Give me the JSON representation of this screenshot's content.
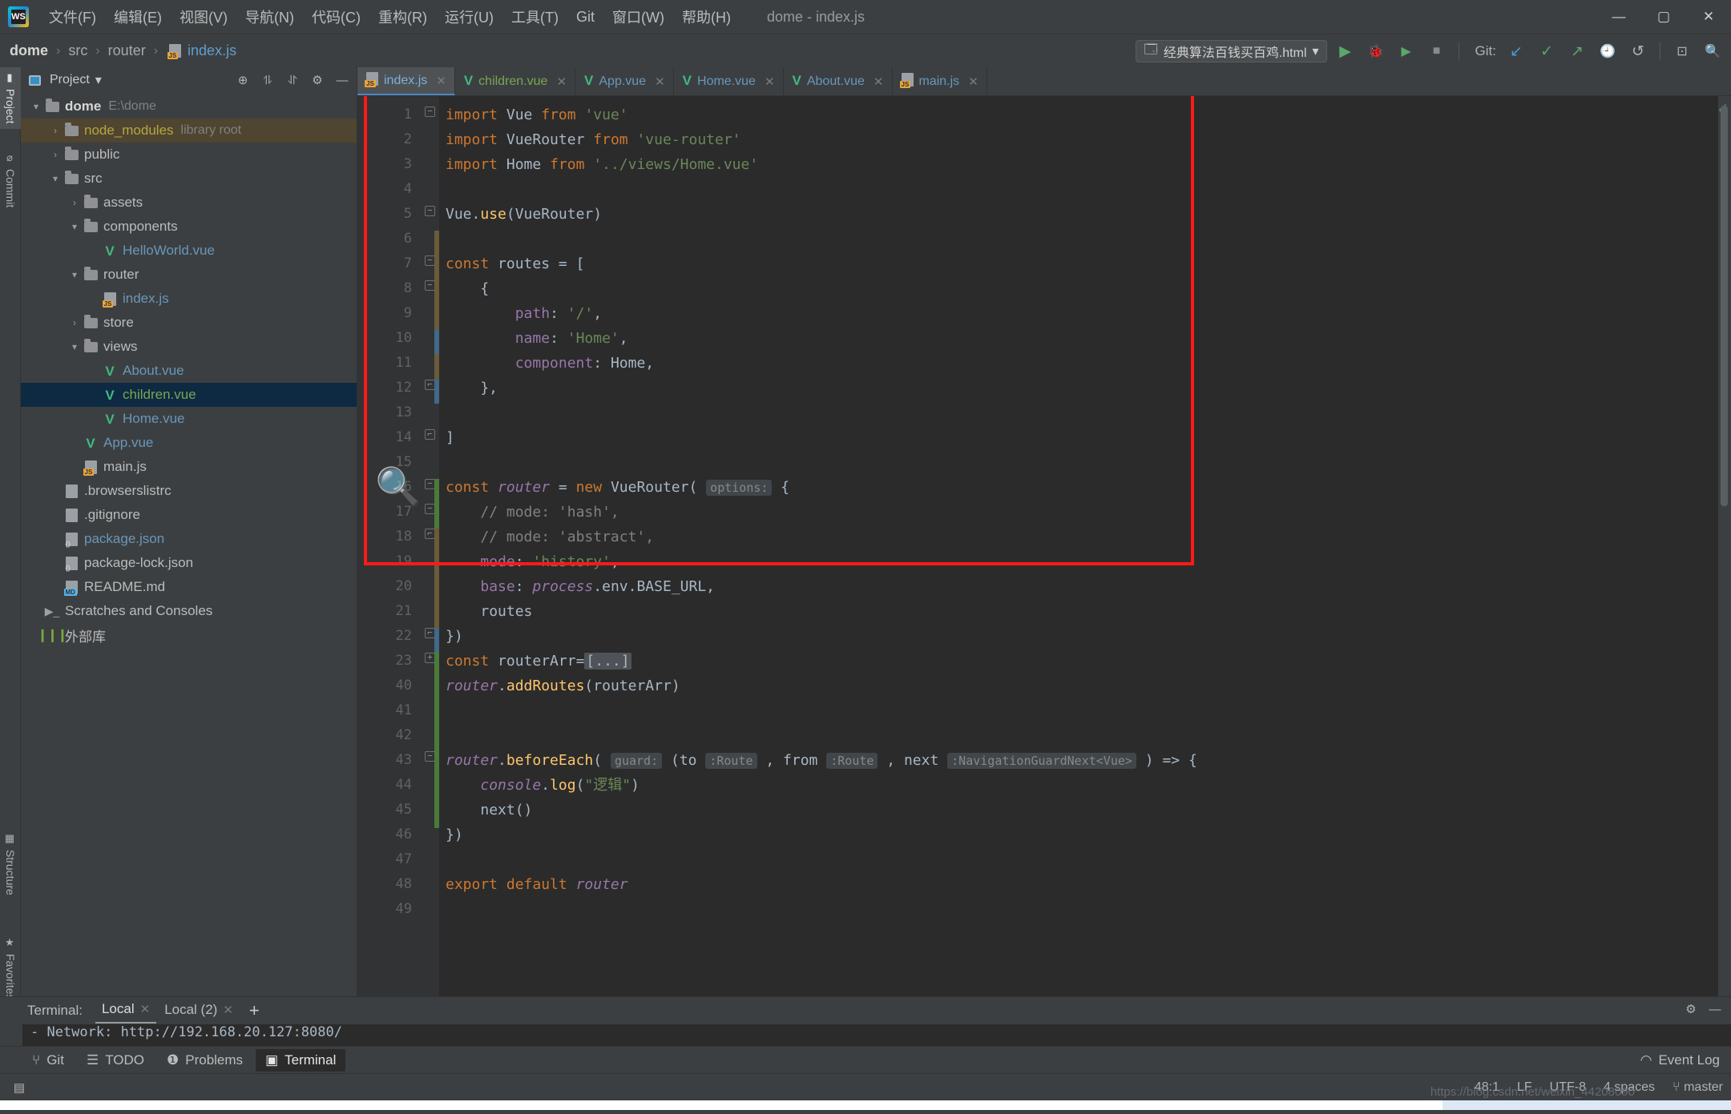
{
  "window": {
    "app_icon": "webstorm-logo",
    "document_title": "dome - index.js",
    "controls": {
      "minimize": "—",
      "maximize": "▢",
      "close": "✕"
    }
  },
  "menubar": {
    "items": [
      {
        "label": "文件(F)",
        "name": "file"
      },
      {
        "label": "编辑(E)",
        "name": "edit"
      },
      {
        "label": "视图(V)",
        "name": "view"
      },
      {
        "label": "导航(N)",
        "name": "navigate"
      },
      {
        "label": "代码(C)",
        "name": "code"
      },
      {
        "label": "重构(R)",
        "name": "refactor"
      },
      {
        "label": "运行(U)",
        "name": "run"
      },
      {
        "label": "工具(T)",
        "name": "tools"
      },
      {
        "label": "Git",
        "name": "git"
      },
      {
        "label": "窗口(W)",
        "name": "window"
      },
      {
        "label": "帮助(H)",
        "name": "help"
      }
    ]
  },
  "breadcrumb": {
    "root": "dome",
    "segments": [
      "src",
      "router"
    ],
    "file": "index.js",
    "separator": "›"
  },
  "toolbar": {
    "run_configuration": "经典算法百钱买百鸡.html",
    "dropdown_arrow": "▾",
    "run_label": "▶",
    "debug_label": "🐞",
    "coverage_label": "▶",
    "stop_label": "■",
    "git_label": "Git:",
    "git_update": "↙",
    "git_commit": "✓",
    "git_push": "↗",
    "git_history": "🕘",
    "git_rollback": "↺",
    "search_everywhere": "🔍",
    "hide_window": "⊡"
  },
  "left_strip": {
    "tabs": [
      {
        "label": "Project",
        "icon": "project-icon",
        "active": true
      },
      {
        "label": "Commit",
        "icon": "commit-icon",
        "active": false
      },
      {
        "label": "Structure",
        "icon": "structure-icon",
        "active": false
      },
      {
        "label": "Favorites",
        "icon": "star-icon",
        "active": false
      }
    ]
  },
  "project_panel": {
    "title": "Project",
    "title_arrow": "▾",
    "actions": [
      "target-icon",
      "collapse-all-icon",
      "expand-icon",
      "settings-gear-icon",
      "hide-icon"
    ],
    "tree": [
      {
        "indent": 0,
        "arrow": "▾",
        "icon": "folder",
        "label": "dome",
        "style": "bold",
        "note": "E:\\dome",
        "state": "normal"
      },
      {
        "indent": 1,
        "arrow": "›",
        "icon": "folder",
        "label": "node_modules",
        "style": "yellow",
        "note": "library root",
        "state": "highlight"
      },
      {
        "indent": 1,
        "arrow": "›",
        "icon": "folder",
        "label": "public",
        "style": "plain",
        "note": "",
        "state": "normal"
      },
      {
        "indent": 1,
        "arrow": "▾",
        "icon": "folder",
        "label": "src",
        "style": "plain",
        "note": "",
        "state": "normal"
      },
      {
        "indent": 2,
        "arrow": "›",
        "icon": "folder",
        "label": "assets",
        "style": "plain",
        "note": "",
        "state": "normal"
      },
      {
        "indent": 2,
        "arrow": "▾",
        "icon": "folder",
        "label": "components",
        "style": "plain",
        "note": "",
        "state": "normal"
      },
      {
        "indent": 3,
        "arrow": "",
        "icon": "vue",
        "label": "HelloWorld.vue",
        "style": "blue",
        "note": "",
        "state": "normal"
      },
      {
        "indent": 2,
        "arrow": "▾",
        "icon": "folder",
        "label": "router",
        "style": "plain",
        "note": "",
        "state": "normal"
      },
      {
        "indent": 3,
        "arrow": "",
        "icon": "js",
        "label": "index.js",
        "style": "blue",
        "note": "",
        "state": "normal"
      },
      {
        "indent": 2,
        "arrow": "›",
        "icon": "folder",
        "label": "store",
        "style": "plain",
        "note": "",
        "state": "normal"
      },
      {
        "indent": 2,
        "arrow": "▾",
        "icon": "folder",
        "label": "views",
        "style": "plain",
        "note": "",
        "state": "normal"
      },
      {
        "indent": 3,
        "arrow": "",
        "icon": "vue",
        "label": "About.vue",
        "style": "blue",
        "note": "",
        "state": "normal"
      },
      {
        "indent": 3,
        "arrow": "",
        "icon": "vue",
        "label": "children.vue",
        "style": "green",
        "note": "",
        "state": "selected"
      },
      {
        "indent": 3,
        "arrow": "",
        "icon": "vue",
        "label": "Home.vue",
        "style": "blue",
        "note": "",
        "state": "normal"
      },
      {
        "indent": 2,
        "arrow": "",
        "icon": "vue",
        "label": "App.vue",
        "style": "blue",
        "note": "",
        "state": "normal"
      },
      {
        "indent": 2,
        "arrow": "",
        "icon": "js",
        "label": "main.js",
        "style": "plain",
        "note": "",
        "state": "normal"
      },
      {
        "indent": 1,
        "arrow": "",
        "icon": "plain",
        "label": ".browserslistrc",
        "style": "plain",
        "note": "",
        "state": "normal"
      },
      {
        "indent": 1,
        "arrow": "",
        "icon": "plain",
        "label": ".gitignore",
        "style": "plain",
        "note": "",
        "state": "normal"
      },
      {
        "indent": 1,
        "arrow": "",
        "icon": "json",
        "label": "package.json",
        "style": "blue",
        "note": "",
        "state": "normal"
      },
      {
        "indent": 1,
        "arrow": "",
        "icon": "json",
        "label": "package-lock.json",
        "style": "plain",
        "note": "",
        "state": "normal"
      },
      {
        "indent": 1,
        "arrow": "",
        "icon": "md",
        "label": "README.md",
        "style": "plain",
        "note": "",
        "state": "normal"
      },
      {
        "indent": 0,
        "arrow": "",
        "icon": "scratch",
        "label": "Scratches and Consoles",
        "style": "plain",
        "note": "",
        "state": "normal"
      },
      {
        "indent": 0,
        "arrow": "",
        "icon": "libs",
        "label": "外部库",
        "style": "plain",
        "note": "",
        "state": "normal"
      }
    ]
  },
  "editor": {
    "tabs": [
      {
        "label": "index.js",
        "icon": "js",
        "color": "blue",
        "active": true
      },
      {
        "label": "children.vue",
        "icon": "vue",
        "color": "green",
        "active": false
      },
      {
        "label": "App.vue",
        "icon": "vue",
        "color": "blue",
        "active": false
      },
      {
        "label": "Home.vue",
        "icon": "vue",
        "color": "blue",
        "active": false
      },
      {
        "label": "About.vue",
        "icon": "vue",
        "color": "blue",
        "active": false
      },
      {
        "label": "main.js",
        "icon": "js",
        "color": "blue",
        "active": false
      }
    ],
    "close_glyph": "✕",
    "inspection_ok": "✓",
    "line_numbers": [
      "1",
      "2",
      "3",
      "4",
      "5",
      "6",
      "7",
      "8",
      "9",
      "10",
      "11",
      "12",
      "13",
      "14",
      "15",
      "16",
      "17",
      "18",
      "19",
      "20",
      "21",
      "22",
      "23",
      "40",
      "41",
      "42",
      "43",
      "44",
      "45",
      "46",
      "47",
      "48",
      "49"
    ],
    "code_lines": [
      "import Vue from 'vue'",
      "import VueRouter from 'vue-router'",
      "import Home from '../views/Home.vue'",
      "",
      "Vue.use(VueRouter)",
      "",
      "const routes = [",
      "    {",
      "        path: '/',",
      "        name: 'Home',",
      "        component: Home,",
      "    },",
      "",
      "]",
      "",
      "const router = new VueRouter( options: {",
      "    // mode: 'hash',",
      "    // mode: 'abstract',",
      "    mode: 'history',",
      "    base: process.env.BASE_URL,",
      "    routes",
      "})",
      "const routerArr=[...]",
      "router.addRoutes(routerArr)",
      "",
      "",
      "router.beforeEach( guard: (to :Route , from :Route , next :NavigationGuardNext<Vue> ) => {",
      "    console.log(\"逻辑\")",
      "    next()",
      "})",
      "",
      "export default router",
      ""
    ],
    "inlay_hints": [
      "options:",
      "guard:",
      ":Route",
      ":Route",
      ":NavigationGuardNext<Vue>"
    ],
    "fold_placeholder": "[...]",
    "annotation": {
      "type": "red-rectangle",
      "magnifier": "🔍"
    }
  },
  "terminal": {
    "label": "Terminal:",
    "tabs": [
      {
        "label": "Local",
        "active": true,
        "close": "✕"
      },
      {
        "label": "Local (2)",
        "active": false,
        "close": "✕"
      }
    ],
    "add": "+",
    "settings_icon": "gear-icon",
    "hide_icon": "—",
    "output_line": "- Network: http://192.168.20.127:8080/"
  },
  "bottom_toolbar": {
    "items": [
      {
        "label": "Git",
        "icon": "git-branch-icon",
        "active": false
      },
      {
        "label": "TODO",
        "icon": "todo-list-icon",
        "active": false
      },
      {
        "label": "Problems",
        "icon": "problems-icon",
        "active": false
      },
      {
        "label": "Terminal",
        "icon": "terminal-icon",
        "active": true
      }
    ],
    "event_log": "Event Log",
    "event_log_icon": "balloon-icon"
  },
  "statusbar": {
    "left_icon": "layout-icon",
    "caret_position": "48:1",
    "line_separator": "LF",
    "encoding": "UTF-8",
    "indent": "4 spaces",
    "branch": "master",
    "branch_icon": "git-branch-icon",
    "watermark": "https://blog.csdn.net/weixin_44208090"
  },
  "colors": {
    "accent": "#4a88c7",
    "keyword": "#cc7832",
    "string": "#6a8759",
    "field": "#9876aa",
    "function": "#ffc66d",
    "comment": "#808080",
    "annotation_red": "#ff1a1a",
    "vue_green": "#42b883",
    "selection_blue": "#0d2a42"
  }
}
